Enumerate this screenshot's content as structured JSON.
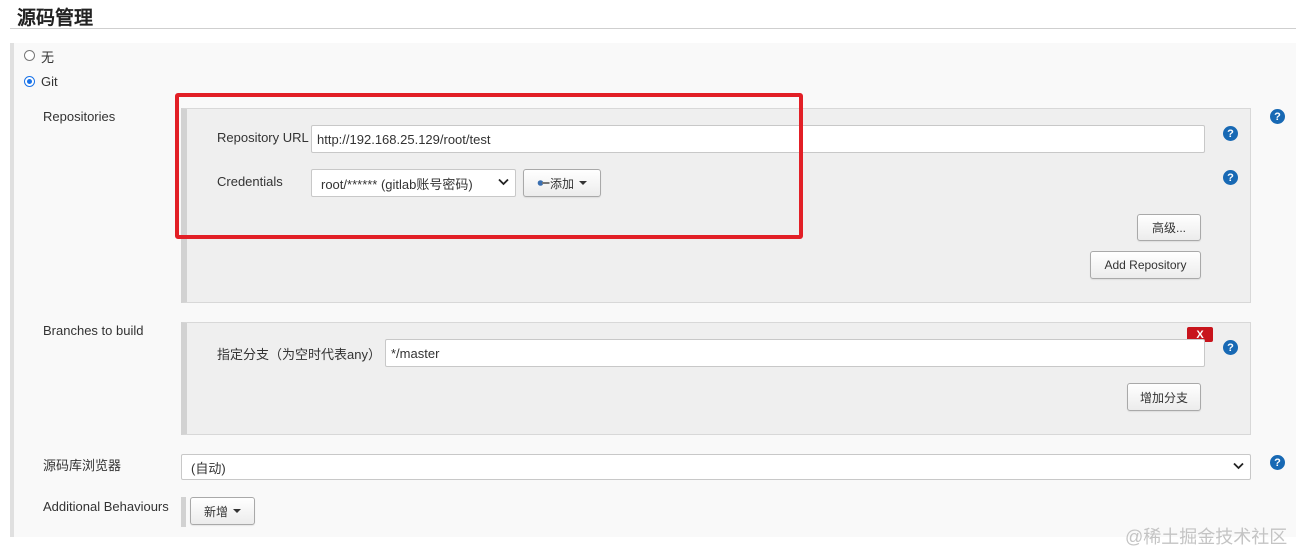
{
  "section": {
    "title": "源码管理"
  },
  "scm_options": [
    {
      "label": "无",
      "selected": false
    },
    {
      "label": "Git",
      "selected": true
    }
  ],
  "repositories": {
    "label": "Repositories",
    "url_label": "Repository URL",
    "url_value": "http://192.168.25.129/root/test",
    "credentials_label": "Credentials",
    "credentials_value": "root/****** (gitlab账号密码)",
    "add_button": "添加",
    "advanced_button": "高级...",
    "add_repository_button": "Add Repository"
  },
  "branches": {
    "label": "Branches to build",
    "branch_label": "指定分支（为空时代表any）",
    "branch_value": "*/master",
    "delete_button": "X",
    "add_branch_button": "增加分支"
  },
  "browser": {
    "label": "源码库浏览器",
    "value": "(自动)"
  },
  "behaviours": {
    "label": "Additional Behaviours",
    "add_button": "新增"
  },
  "help_icon_text": "?",
  "watermark": "@稀土掘金技术社区",
  "colors": {
    "help": "#1869b4",
    "highlight": "#e21f26",
    "delete": "#c8141c",
    "radio_selected": "#1a73e8"
  }
}
